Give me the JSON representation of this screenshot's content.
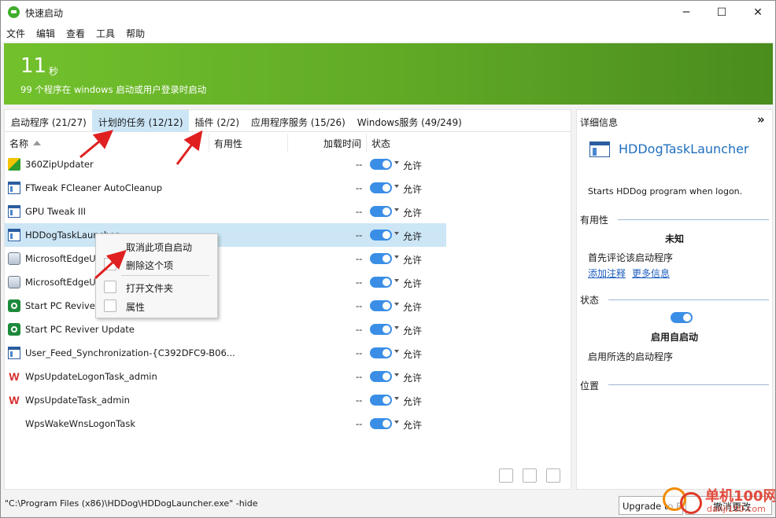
{
  "window": {
    "title": "快速启动",
    "minimize": "─",
    "maximize": "☐",
    "close": "✕"
  },
  "menu": [
    "文件",
    "编辑",
    "查看",
    "工具",
    "帮助"
  ],
  "banner": {
    "seconds": "11",
    "unit": "秒",
    "description": "99 个程序在 windows 启动或用户登录时启动"
  },
  "tabs": [
    {
      "label": "启动程序 (21/27)",
      "active": false
    },
    {
      "label": "计划的任务 (12/12)",
      "active": true
    },
    {
      "label": "插件 (2/2)",
      "active": false
    },
    {
      "label": "应用程序服务 (15/26)",
      "active": false
    },
    {
      "label": "Windows服务 (49/249)",
      "active": false
    }
  ],
  "columns": {
    "name": "名称",
    "usefulness": "有用性",
    "load_time": "加载时间",
    "state": "状态"
  },
  "rows": [
    {
      "name": "360ZipUpdater",
      "icon": "360-icon",
      "load": "--",
      "state": "允许",
      "selected": false
    },
    {
      "name": "FTweak FCleaner AutoCleanup",
      "icon": "window-icon",
      "load": "--",
      "state": "允许",
      "selected": false
    },
    {
      "name": "GPU Tweak III",
      "icon": "window-icon",
      "load": "--",
      "state": "允许",
      "selected": false
    },
    {
      "name": "HDDogTaskLauncher",
      "icon": "window-icon",
      "load": "--",
      "state": "允许",
      "selected": true
    },
    {
      "name": "MicrosoftEdgeUpdateTaskMachineCore",
      "icon": "edge-update-icon",
      "load": "--",
      "state": "允许",
      "selected": false
    },
    {
      "name": "MicrosoftEdgeUpdateTaskMachineUA",
      "icon": "edge-update-icon",
      "load": "--",
      "state": "允许",
      "selected": false
    },
    {
      "name": "Start PC Reviver Scan",
      "icon": "reviver-icon",
      "load": "--",
      "state": "允许",
      "selected": false
    },
    {
      "name": "Start PC Reviver Update",
      "icon": "reviver-icon",
      "load": "--",
      "state": "允许",
      "selected": false
    },
    {
      "name": "User_Feed_Synchronization-{C392DFC9-B06...",
      "icon": "window-icon",
      "load": "--",
      "state": "允许",
      "selected": false
    },
    {
      "name": "WpsUpdateLogonTask_admin",
      "icon": "wps-icon",
      "load": "--",
      "state": "允许",
      "selected": false
    },
    {
      "name": "WpsUpdateTask_admin",
      "icon": "wps-icon",
      "load": "--",
      "state": "允许",
      "selected": false
    },
    {
      "name": "WpsWakeWnsLogonTask",
      "icon": "",
      "load": "--",
      "state": "允许",
      "selected": false
    }
  ],
  "context_menu": {
    "items": [
      {
        "label": "取消此项自启动",
        "icon": ""
      },
      {
        "label": "删除这个项",
        "icon": "delete-icon"
      },
      {
        "label": "打开文件夹",
        "icon": "folder-icon"
      },
      {
        "label": "属性",
        "icon": "properties-icon"
      }
    ]
  },
  "details": {
    "header": "详细信息",
    "collapse": "»",
    "name": "HDDogTaskLauncher",
    "description": "Starts HDDog program when logon.",
    "usefulness_title": "有用性",
    "usefulness_value": "未知",
    "usefulness_hint": "首先评论该启动程序",
    "link_add_note": "添加注释",
    "link_more_info": "更多信息",
    "state_title": "状态",
    "state_value": "启用自启动",
    "state_hint": "启用所选的启动程序",
    "location_title": "位置"
  },
  "status": {
    "path": "\"C:\\Program Files (x86)\\HDDog\\HDDogLauncher.exe\" -hide",
    "upgrade_label": "Upgrade to Pro",
    "undo_label": "撤消更改"
  },
  "watermark": {
    "text": "单机100网",
    "sub": "danji100.com"
  },
  "colors": {
    "accent": "#3a8ee6",
    "banner_start": "#72c12c",
    "banner_end": "#4b8c1e",
    "selection": "#cce6f6",
    "annotation_arrow": "#e02020"
  }
}
